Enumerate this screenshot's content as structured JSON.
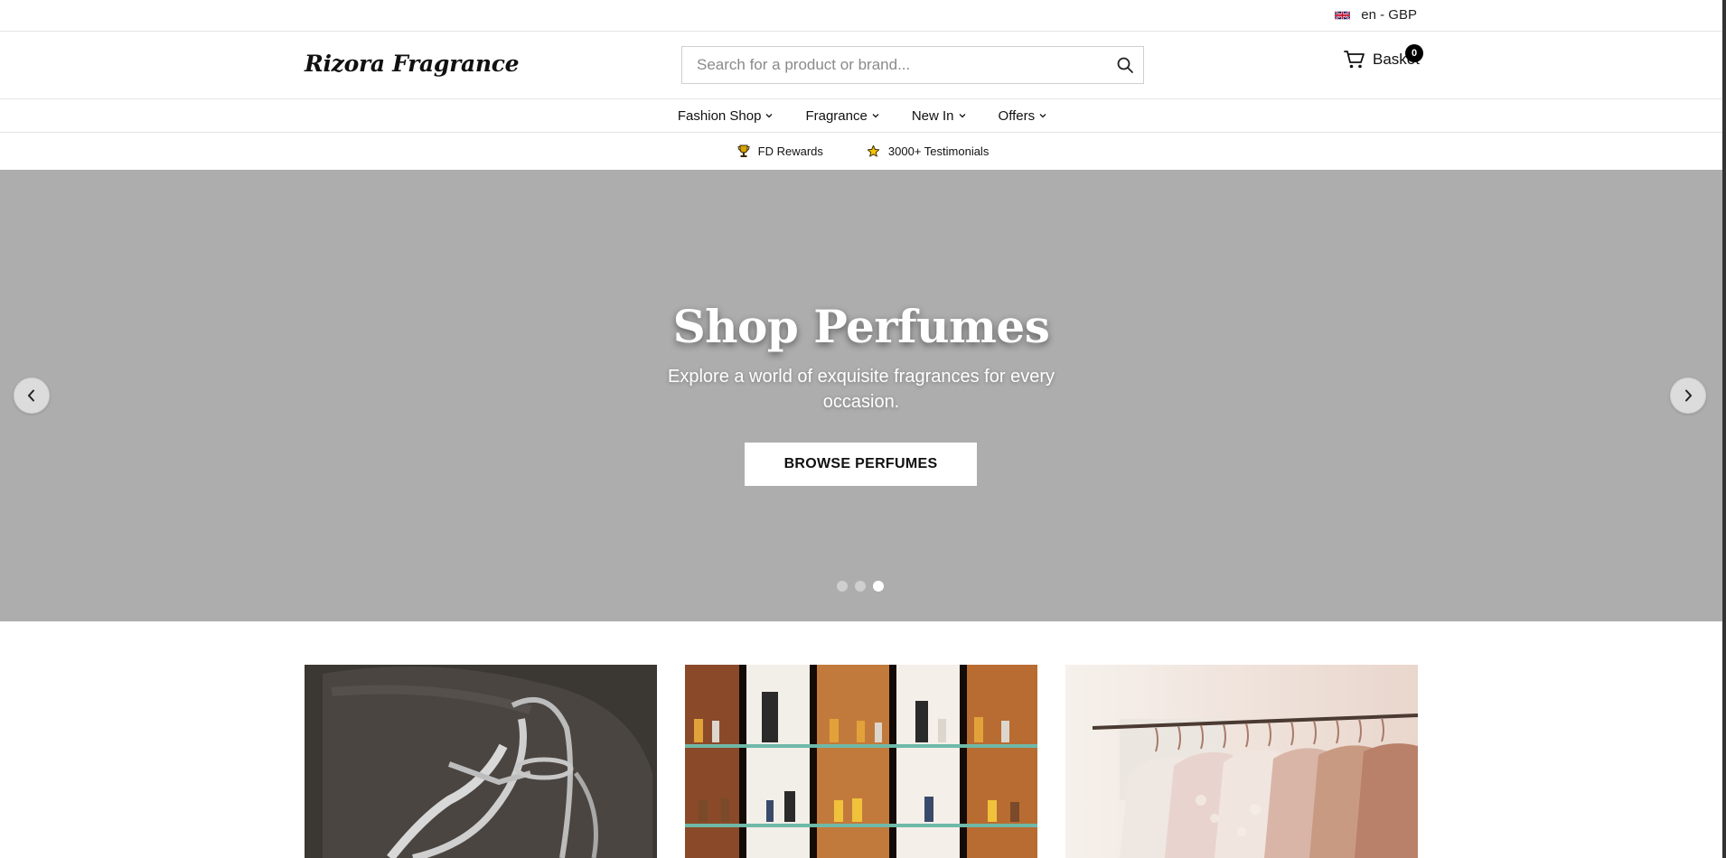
{
  "locale": {
    "label": "en - GBP",
    "flag_icon": "uk-flag-icon"
  },
  "header": {
    "logo": "Rizora Fragrance",
    "search_placeholder": "Search for a product or brand...",
    "basket_label": "Basket",
    "basket_count": "0"
  },
  "nav": {
    "items": [
      {
        "label": "Fashion Shop"
      },
      {
        "label": "Fragrance"
      },
      {
        "label": "New In"
      },
      {
        "label": "Offers"
      }
    ]
  },
  "promo": {
    "items": [
      {
        "label": "FD Rewards",
        "icon": "trophy-icon"
      },
      {
        "label": "3000+ Testimonials",
        "icon": "star-icon"
      }
    ]
  },
  "hero": {
    "title": "Shop Perfumes",
    "subtitle": "Explore a world of exquisite fragrances for every occasion.",
    "button": "BROWSE PERFUMES",
    "slide_count": 3,
    "active_slide": 3
  },
  "cards": [
    {
      "image": "silver-heeled-sandal-image"
    },
    {
      "image": "perfume-shelves-image"
    },
    {
      "image": "clothing-rack-image"
    }
  ],
  "colors": {
    "hero_bg": "#adadad",
    "accent": "#000000"
  }
}
